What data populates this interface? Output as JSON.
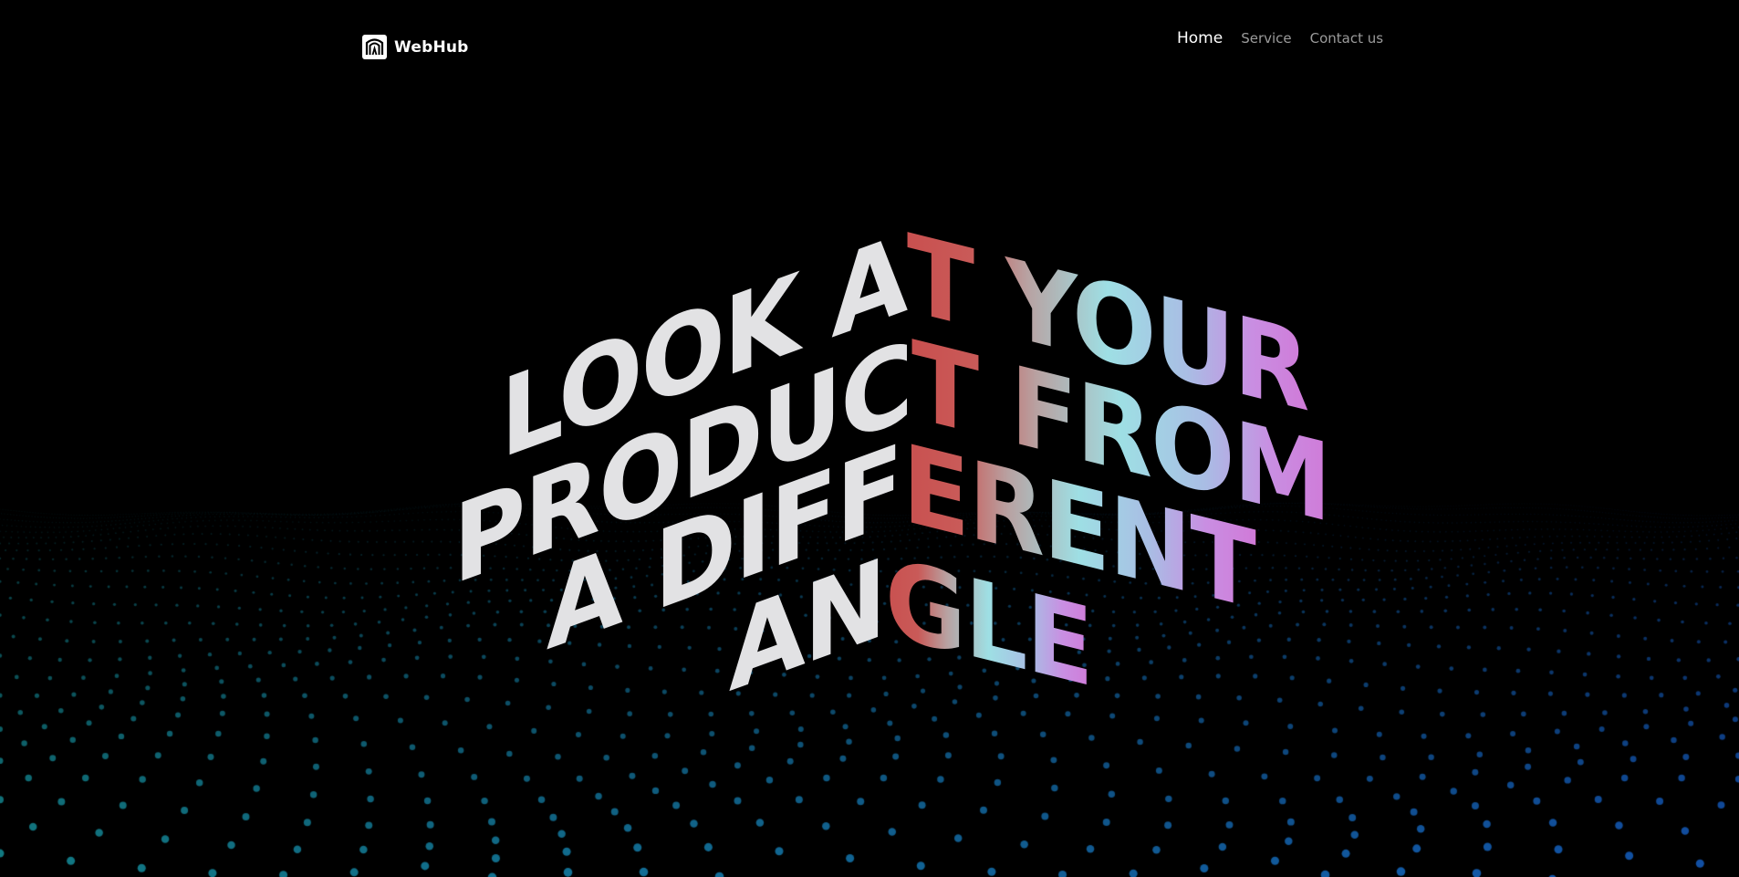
{
  "brand": {
    "name": "WebHub",
    "logo_icon": "webhub-logo-icon"
  },
  "nav": {
    "home": "Home",
    "service": "Service",
    "contact": "Contact us"
  },
  "hero": {
    "lines": [
      {
        "left": "LOOK A",
        "right": "T YOUR"
      },
      {
        "left": "PRODUC",
        "right": "T FROM"
      },
      {
        "left": "A DIFF",
        "right": "ERENT"
      },
      {
        "left": "AN",
        "right": "GLE"
      }
    ]
  },
  "colors": {
    "background": "#000000",
    "headline_left": "#e2e2e4",
    "gradient_red": "#c9504f",
    "gradient_cyan": "#9edfe4",
    "gradient_pink": "#d07ad8",
    "dots_teal": "#1aa8a0",
    "dots_blue": "#1a6fa8"
  }
}
